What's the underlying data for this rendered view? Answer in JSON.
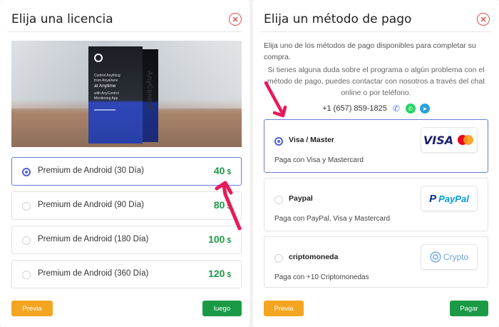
{
  "left": {
    "title": "Elija una licencia",
    "product_image_alt": "AnyControl product box",
    "box_text": {
      "line1": "Control Anything",
      "line2": "from Anywhere",
      "line3": "at Anytime",
      "line4": "with AnyControl",
      "line5": "Monitoring App",
      "side": "AnyControl"
    },
    "options": [
      {
        "label": "Premium de Android (30 Día)",
        "price": "40",
        "currency": "$",
        "selected": true
      },
      {
        "label": "Premium de Android (90 Día)",
        "price": "80",
        "currency": "$",
        "selected": false
      },
      {
        "label": "Premium de Android (180 Día)",
        "price": "100",
        "currency": "$",
        "selected": false
      },
      {
        "label": "Premium de Android (360 Día)",
        "price": "120",
        "currency": "$",
        "selected": false
      }
    ],
    "prev_label": "Previa",
    "next_label": "luego"
  },
  "right": {
    "title": "Elija un método de pago",
    "intro": "Elija uno de los métodos de pago disponibles para completar su compra.",
    "help": "Si tienes alguna duda sobre el programa o algún problema con el método de pago, puedes contactar con nosotros a través del chat online o por teléfono.",
    "phone": "+1 (657) 859-1825",
    "methods": [
      {
        "name": "Visa / Master",
        "desc": "Paga con Visa y Mastercard",
        "logo": "VISA",
        "selected": true
      },
      {
        "name": "Paypal",
        "desc": "Paga con PayPal, Visa y Mastercard",
        "logo": "PayPal",
        "selected": false
      },
      {
        "name": "criptomoneda",
        "desc": "Paga con +10 Criptomonedas",
        "logo": "Crypto",
        "selected": false
      }
    ],
    "prev_label": "Previa",
    "pay_label": "Pagar"
  },
  "colors": {
    "accent_blue": "#5161d1",
    "price_green": "#1e9a47",
    "button_orange": "#f4a520",
    "button_green": "#1a9a46",
    "close_red": "#e05050",
    "annotation_arrow": "#e8195a"
  },
  "icons": [
    "close-icon",
    "phone-icon",
    "whatsapp-icon",
    "telegram-icon",
    "crypto-icon"
  ]
}
